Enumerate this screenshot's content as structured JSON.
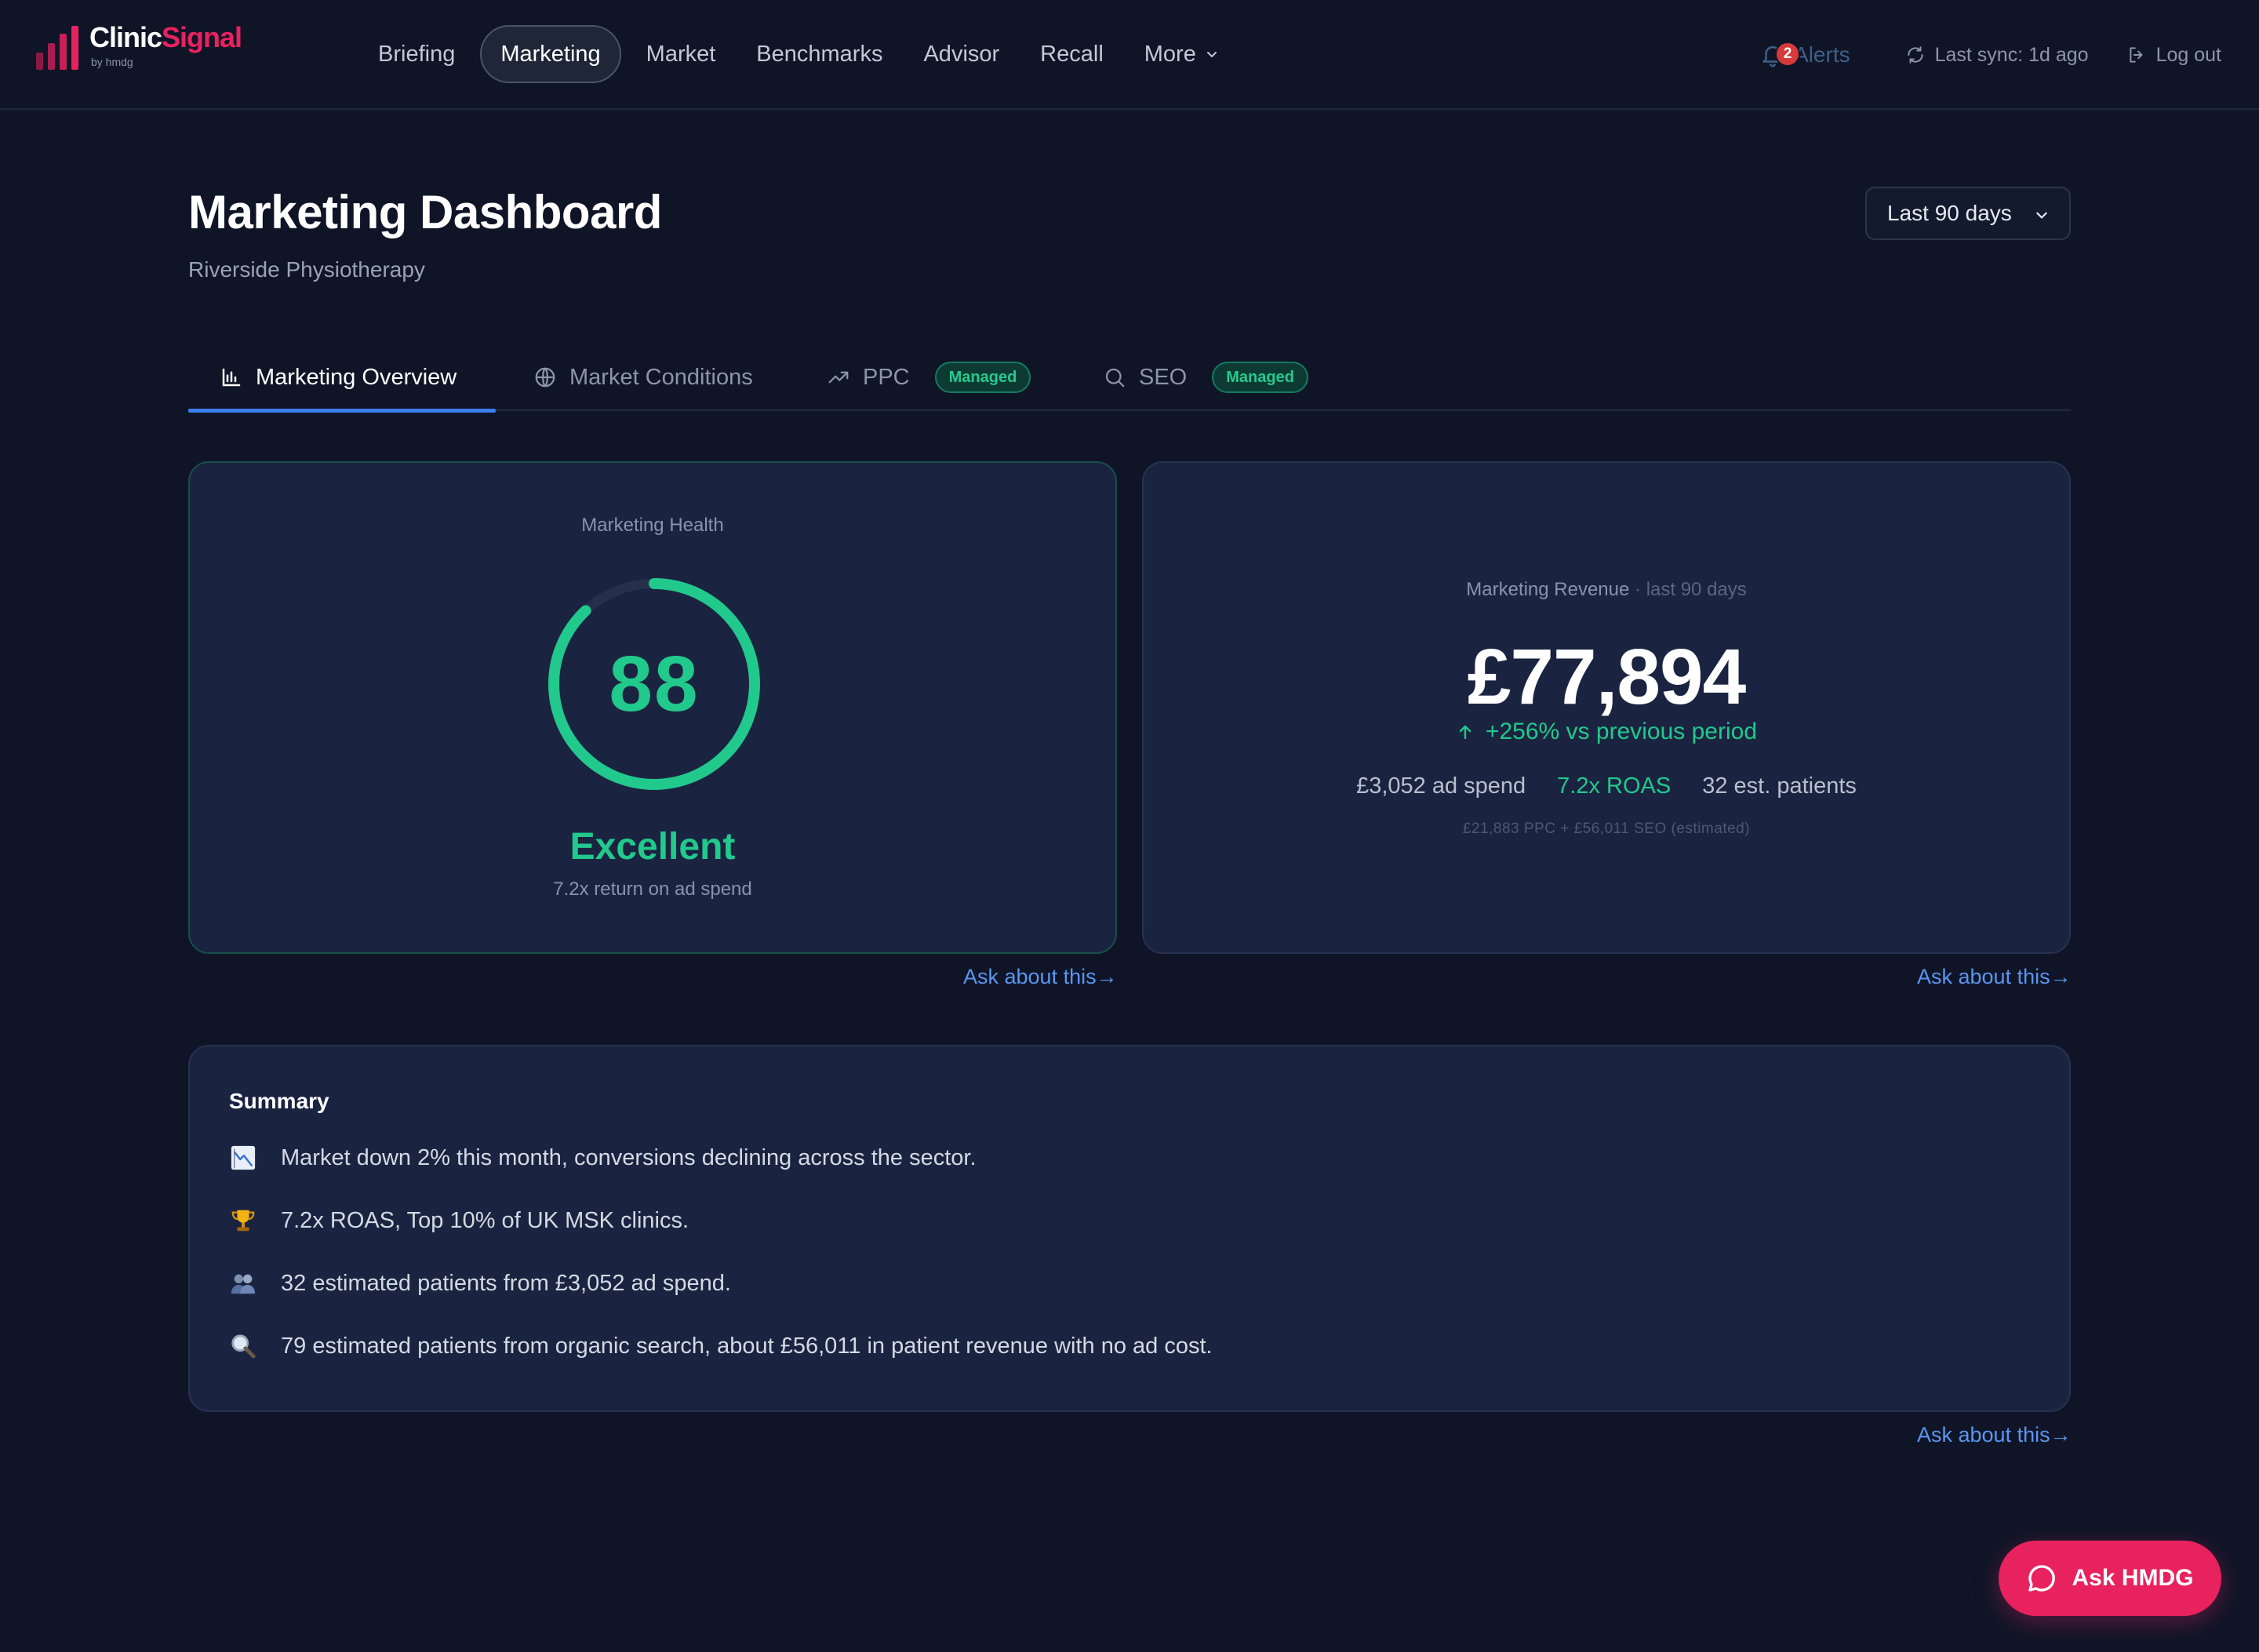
{
  "brand": {
    "name_part1": "Clinic",
    "name_part2": "Signal",
    "sub": "by hmdg",
    "color": "#e8225f"
  },
  "nav": {
    "items": [
      "Briefing",
      "Marketing",
      "Market",
      "Benchmarks",
      "Advisor",
      "Recall",
      "More"
    ],
    "active": "Marketing"
  },
  "topright": {
    "alerts_label": "Alerts",
    "alerts_count": "2",
    "sync_label": "Last sync: 1d ago",
    "logout_label": "Log out"
  },
  "page": {
    "title": "Marketing Dashboard",
    "subtitle": "Riverside Physiotherapy",
    "range": "Last 90 days"
  },
  "tabs": [
    {
      "label": "Marketing Overview",
      "icon": "bar-chart-icon",
      "active": true
    },
    {
      "label": "Market Conditions",
      "icon": "globe-icon"
    },
    {
      "label": "PPC",
      "icon": "trending-up-icon",
      "badge": "Managed"
    },
    {
      "label": "SEO",
      "icon": "search-icon",
      "badge": "Managed"
    }
  ],
  "health": {
    "label": "Marketing Health",
    "score": "88",
    "score_pct": 88,
    "status": "Excellent",
    "note": "7.2x return on ad spend",
    "color": "#22c98c"
  },
  "revenue": {
    "label": "Marketing Revenue",
    "period": "· last 90 days",
    "value": "£77,894",
    "change": "+256% vs previous period",
    "ad_spend": "£3,052 ad spend",
    "roas": "7.2x ROAS",
    "patients": "32 est. patients",
    "breakdown": "£21,883 PPC + £56,011 SEO (estimated)"
  },
  "ask_label": "Ask about this→",
  "summary": {
    "title": "Summary",
    "items": [
      {
        "icon": "chart-down-icon",
        "text": "Market down 2% this month, conversions declining across the sector."
      },
      {
        "icon": "trophy-icon",
        "text": "7.2x ROAS, Top 10% of UK MSK clinics."
      },
      {
        "icon": "people-icon",
        "text": "32 estimated patients from £3,052 ad spend."
      },
      {
        "icon": "magnifier-icon",
        "text": "79 estimated patients from organic search, about £56,011 in patient revenue with no ad cost."
      }
    ]
  },
  "fab": {
    "label": "Ask HMDG"
  }
}
